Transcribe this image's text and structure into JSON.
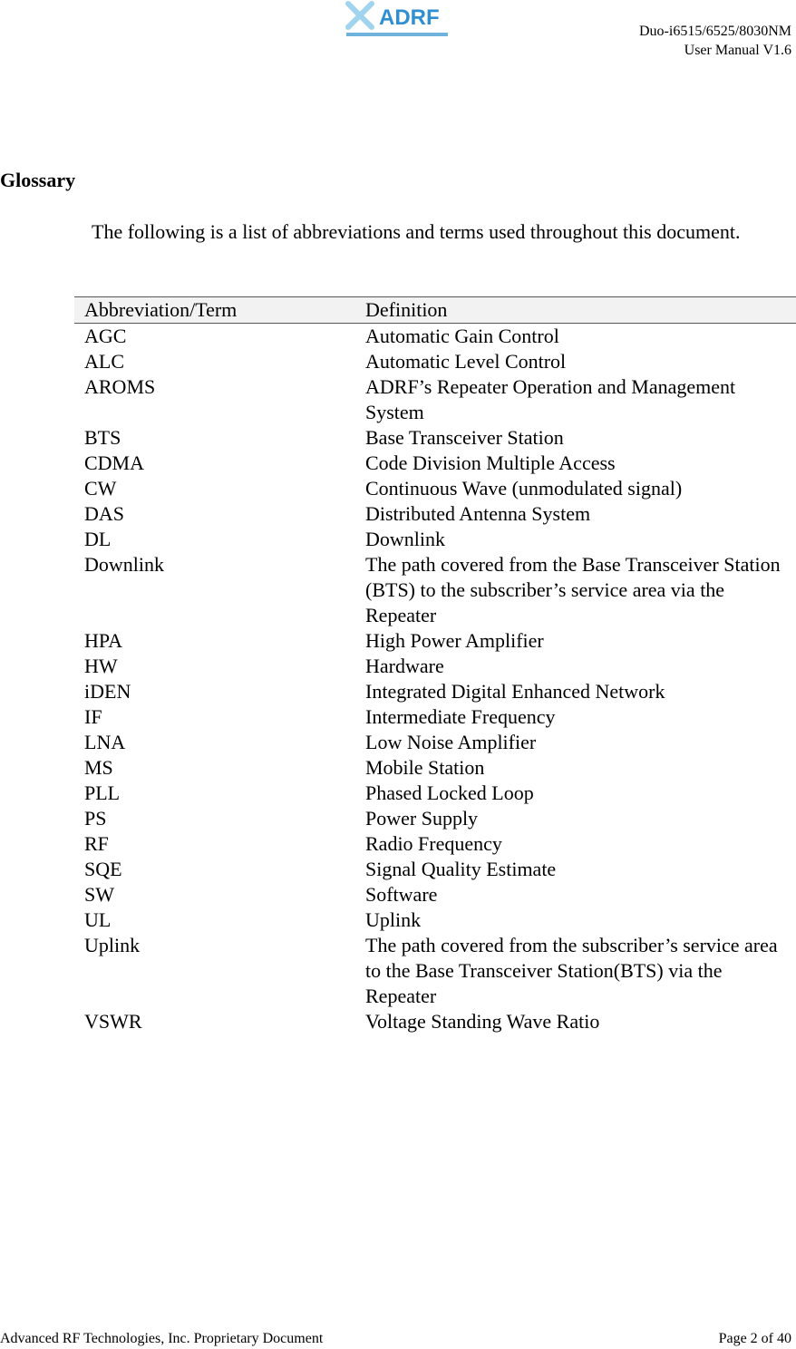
{
  "header": {
    "logo_text": "ADRF",
    "product": "Duo-i6515/6525/8030NM",
    "manual": "User Manual V1.6"
  },
  "title": "Glossary",
  "intro": "The following is a list of abbreviations and terms used throughout this document.",
  "table": {
    "headers": [
      "Abbreviation/Term",
      "Definition"
    ],
    "rows": [
      [
        "AGC",
        "Automatic Gain Control"
      ],
      [
        "ALC",
        "Automatic Level Control"
      ],
      [
        "AROMS",
        "ADRF’s Repeater Operation and Management System"
      ],
      [
        "BTS",
        "Base Transceiver Station"
      ],
      [
        "CDMA",
        "Code Division Multiple Access"
      ],
      [
        "CW",
        "Continuous Wave (unmodulated signal)"
      ],
      [
        "DAS",
        "Distributed Antenna System"
      ],
      [
        "DL",
        "Downlink"
      ],
      [
        "Downlink",
        "The path covered from the Base Transceiver Station (BTS) to the subscriber’s service area via the Repeater"
      ],
      [
        "HPA",
        "High Power Amplifier"
      ],
      [
        "HW",
        "Hardware"
      ],
      [
        "iDEN",
        "Integrated Digital Enhanced Network"
      ],
      [
        "IF",
        "Intermediate Frequency"
      ],
      [
        "LNA",
        "Low Noise Amplifier"
      ],
      [
        "MS",
        "Mobile Station"
      ],
      [
        "PLL",
        "Phased Locked Loop"
      ],
      [
        "PS",
        "Power Supply"
      ],
      [
        "RF",
        "Radio Frequency"
      ],
      [
        "SQE",
        "Signal Quality Estimate"
      ],
      [
        "SW",
        "Software"
      ],
      [
        "UL",
        "Uplink"
      ],
      [
        "Uplink",
        "The path covered from the subscriber’s service area to the Base Transceiver Station(BTS) via the Repeater"
      ],
      [
        "VSWR",
        "Voltage Standing Wave Ratio"
      ]
    ]
  },
  "footer": {
    "left": "Advanced RF Technologies, Inc. Proprietary Document",
    "right": "Page 2 of 40"
  }
}
